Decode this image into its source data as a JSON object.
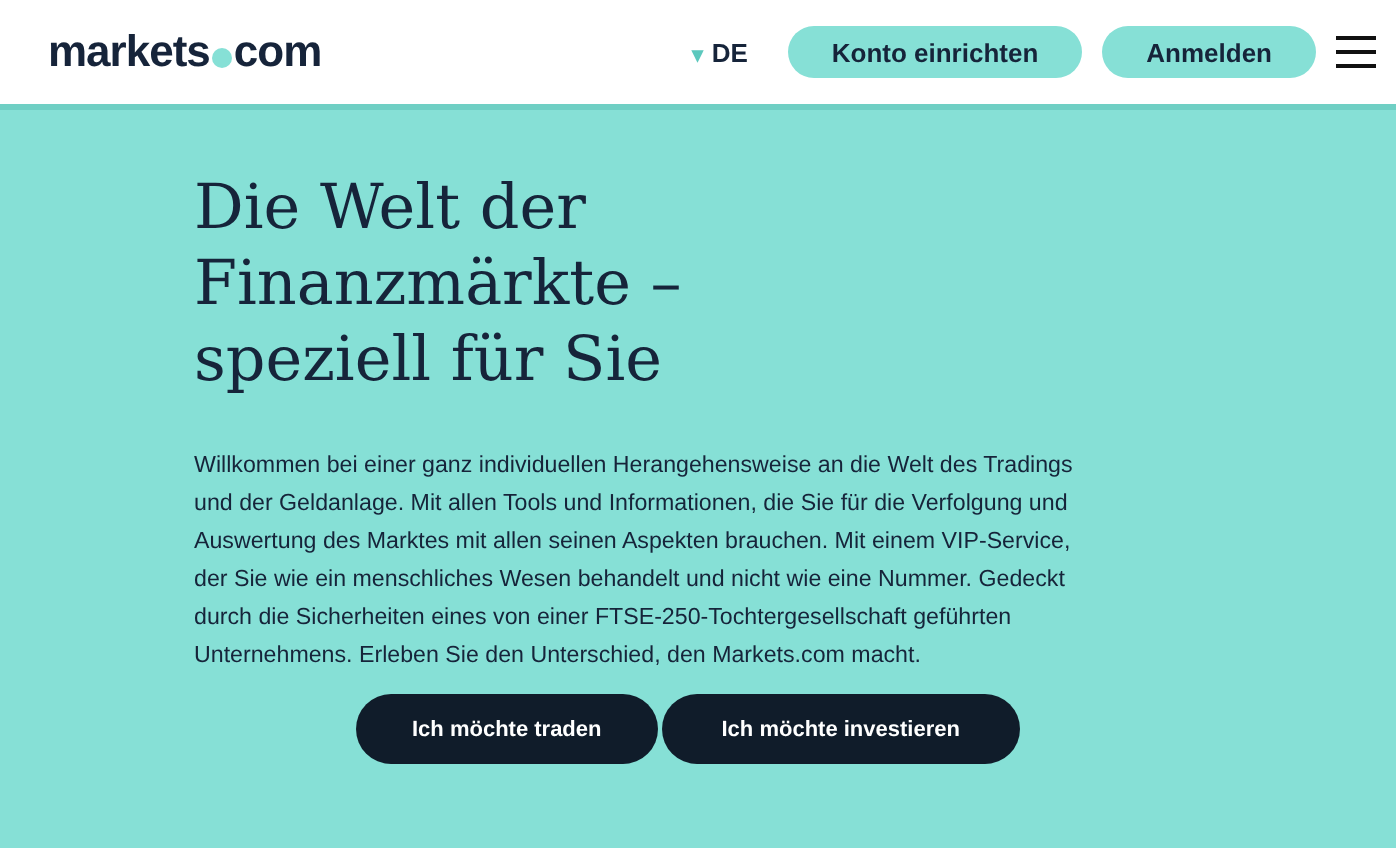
{
  "header": {
    "logo": {
      "left": "markets",
      "right": "com"
    },
    "language": {
      "icon": "▾",
      "label": "DE"
    },
    "buttons": [
      "Konto einrichten",
      "Anmelden"
    ]
  },
  "hero": {
    "title": "Die Welt der Finanzmärkte – speziell für Sie",
    "text": "Willkommen bei einer ganz individuellen Herangehensweise an die Welt des Tradings und der Geldanlage. Mit allen Tools und Informationen, die Sie für die Verfolgung und Auswertung des Marktes mit allen seinen Aspekten brauchen. Mit einem VIP-Service, der Sie wie ein menschliches Wesen behandelt und nicht wie eine Nummer. Gedeckt durch die Sicherheiten eines von einer FTSE-250-Tochtergesellschaft geführten Unternehmens. Erleben Sie den Unterschied, den Markets.com macht.",
    "buttons": [
      "Ich möchte traden",
      "Ich möchte investieren"
    ]
  }
}
